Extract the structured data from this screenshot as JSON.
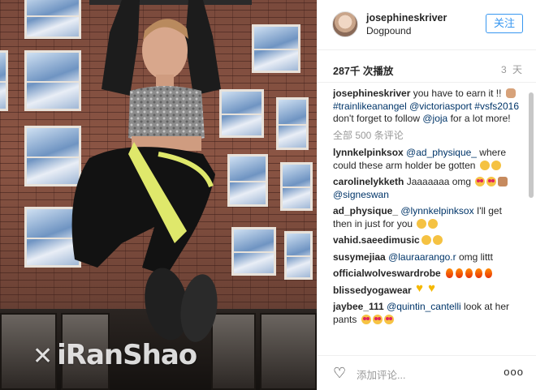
{
  "header": {
    "username": "josephineskriver",
    "location": "Dogpound",
    "follow_label": "关注"
  },
  "stats": {
    "views": "287千 次播放",
    "age": "3 天"
  },
  "caption": {
    "username": "josephineskriver",
    "text1": " you have to earn it !! ",
    "tag1": "#trainlikeanangel",
    "tag2": "@victoriasport",
    "tag3": "#vsfs2016",
    "text2": " don't forget to follow ",
    "tag4": "@joja",
    "text3": " for a lot more!"
  },
  "all_comments_label": "全部 500 条评论",
  "comments": [
    {
      "user": "lynnkelpinksox",
      "mention": "@ad_physique_",
      "text": " where could these arm holder be gotten "
    },
    {
      "user": "carolinelykketh",
      "text": " Jaaaaaaa omg ",
      "mention2": "@signeswan"
    },
    {
      "user": "ad_physique_",
      "mention": "@lynnkelpinksox",
      "text": " I'll get then in just for you "
    },
    {
      "user": "vahid.saeedimusic",
      "text": ""
    },
    {
      "user": "susymejiaa",
      "mention": "@lauraarango.r",
      "text": " omg littt"
    },
    {
      "user": "officialwolveswardrobe",
      "text": ""
    },
    {
      "user": "blissedyogawear",
      "text": ""
    },
    {
      "user": "jaybee_111",
      "mention": "@quintin_cantelli",
      "text": " look at her pants "
    }
  ],
  "footer": {
    "add_comment_placeholder": "添加评论...",
    "more_label": "ooo"
  },
  "watermark": {
    "text": "iRanShao"
  },
  "icons": [
    "heart-icon",
    "more-options-icon",
    "avatar"
  ]
}
